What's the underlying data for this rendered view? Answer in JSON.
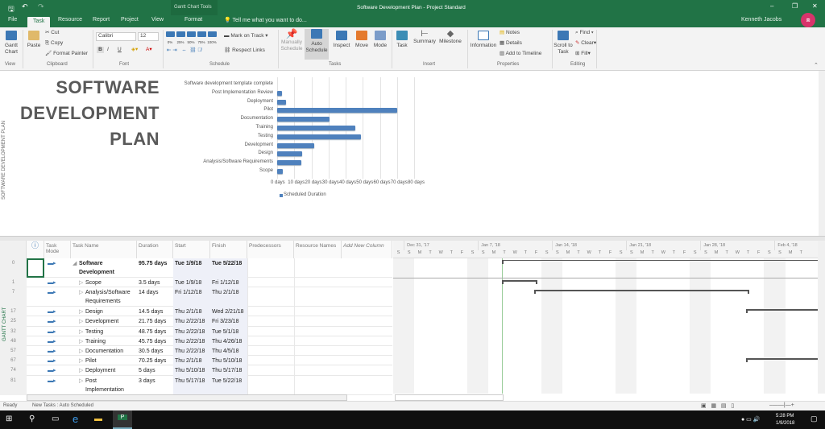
{
  "window": {
    "title": "Software Development Plan - Project Standard",
    "context_tab_group": "Gantt Chart Tools",
    "user": "Kenneth Jacobs"
  },
  "tabs": [
    "File",
    "Task",
    "Resource",
    "Report",
    "Project",
    "View",
    "Format"
  ],
  "active_tab": "Task",
  "tell_me": "Tell me what you want to do...",
  "ribbon": {
    "view": {
      "gantt": "Gantt Chart",
      "group": "View"
    },
    "clipboard": {
      "paste": "Paste",
      "cut": "Cut",
      "copy": "Copy",
      "format_painter": "Format Painter",
      "group": "Clipboard"
    },
    "font": {
      "family": "Calibri",
      "size": "12",
      "bold": "B",
      "italic": "I",
      "underline": "U",
      "group": "Font"
    },
    "schedule": {
      "mark_on_track": "Mark on Track",
      "respect_links": "Respect Links",
      "percents": [
        "0%",
        "25%",
        "50%",
        "75%",
        "100%"
      ],
      "group": "Schedule"
    },
    "tasks": {
      "manually": "Manually Schedule",
      "auto": "Auto Schedule",
      "inspect": "Inspect",
      "move": "Move",
      "mode": "Mode",
      "group": "Tasks"
    },
    "insert": {
      "task": "Task",
      "summary": "Summary",
      "milestone": "Milestone",
      "group": "Insert"
    },
    "properties": {
      "information": "Information",
      "notes": "Notes",
      "details": "Details",
      "add_timeline": "Add to Timeline",
      "group": "Properties"
    },
    "editing": {
      "scroll": "Scroll to Task",
      "find": "Find",
      "clear": "Clear",
      "fill": "Fill",
      "group": "Editing"
    }
  },
  "report": {
    "side_label": "SOFTWARE DEVELOPMENT PLAN",
    "title_lines": [
      "SOFTWARE",
      "DEVELOPMENT",
      "PLAN"
    ]
  },
  "chart_data": {
    "type": "bar",
    "orientation": "horizontal",
    "categories": [
      "Software development template complete",
      "Post Implementation Review",
      "Deployment",
      "Pilot",
      "Documentation",
      "Training",
      "Testing",
      "Development",
      "Design",
      "Analysis/Software Requirements",
      "Scope"
    ],
    "series": [
      {
        "name": "Scheduled Duration",
        "values": [
          0,
          3,
          5,
          70.25,
          30.5,
          45.75,
          48.75,
          21.75,
          14.5,
          14,
          3.5
        ],
        "color": "#4f81bd"
      }
    ],
    "xticks": [
      "0 days",
      "10 days",
      "20 days",
      "30 days",
      "40 days",
      "50 days",
      "60 days",
      "70 days",
      "80 days"
    ],
    "xlim": [
      0,
      80
    ],
    "grid": true,
    "legend": "bottom"
  },
  "table": {
    "side_label": "GANTT CHART",
    "headers": {
      "mode": "Task Mode",
      "name": "Task Name",
      "duration": "Duration",
      "start": "Start",
      "finish": "Finish",
      "pred": "Predecessors",
      "res": "Resource Names",
      "add": "Add New Column"
    },
    "rows": [
      {
        "id": "0",
        "name": "Software Development",
        "duration": "95.75 days",
        "start": "Tue 1/9/18",
        "finish": "Tue 5/22/18",
        "summary": true
      },
      {
        "id": "1",
        "name": "Scope",
        "duration": "3.5 days",
        "start": "Tue 1/9/18",
        "finish": "Fri 1/12/18"
      },
      {
        "id": "7",
        "name": "Analysis/Software Requirements",
        "duration": "14 days",
        "start": "Fri 1/12/18",
        "finish": "Thu 2/1/18"
      },
      {
        "id": "17",
        "name": "Design",
        "duration": "14.5 days",
        "start": "Thu 2/1/18",
        "finish": "Wed 2/21/18"
      },
      {
        "id": "25",
        "name": "Development",
        "duration": "21.75 days",
        "start": "Thu 2/22/18",
        "finish": "Fri 3/23/18"
      },
      {
        "id": "32",
        "name": "Testing",
        "duration": "48.75 days",
        "start": "Thu 2/22/18",
        "finish": "Tue 5/1/18"
      },
      {
        "id": "48",
        "name": "Training",
        "duration": "45.75 days",
        "start": "Thu 2/22/18",
        "finish": "Thu 4/26/18"
      },
      {
        "id": "57",
        "name": "Documentation",
        "duration": "30.5 days",
        "start": "Thu 2/22/18",
        "finish": "Thu 4/5/18"
      },
      {
        "id": "67",
        "name": "Pilot",
        "duration": "70.25 days",
        "start": "Thu 2/1/18",
        "finish": "Thu 5/10/18"
      },
      {
        "id": "74",
        "name": "Deployment",
        "duration": "5 days",
        "start": "Thu 5/10/18",
        "finish": "Thu 5/17/18"
      },
      {
        "id": "81",
        "name": "Post Implementation",
        "duration": "3 days",
        "start": "Thu 5/17/18",
        "finish": "Tue 5/22/18"
      }
    ]
  },
  "timescale": {
    "weeks": [
      "Dec 31, '17",
      "Jan 7, '18",
      "Jan 14, '18",
      "Jan 21, '18",
      "Jan 28, '18",
      "Feb 4, '18"
    ],
    "days": [
      "S",
      "S",
      "M",
      "T",
      "W",
      "T",
      "F",
      "S",
      "S",
      "M",
      "T",
      "W",
      "T",
      "F",
      "S",
      "S",
      "M",
      "T",
      "W",
      "T",
      "F",
      "S",
      "S",
      "M",
      "T",
      "W",
      "T",
      "F",
      "S",
      "S",
      "M",
      "T",
      "W",
      "T",
      "F",
      "S",
      "S",
      "M",
      "T"
    ]
  },
  "status": {
    "ready": "Ready",
    "new_tasks": "New Tasks : Auto Scheduled"
  },
  "taskbar": {
    "time": "5:28 PM",
    "date": "1/9/2018"
  }
}
